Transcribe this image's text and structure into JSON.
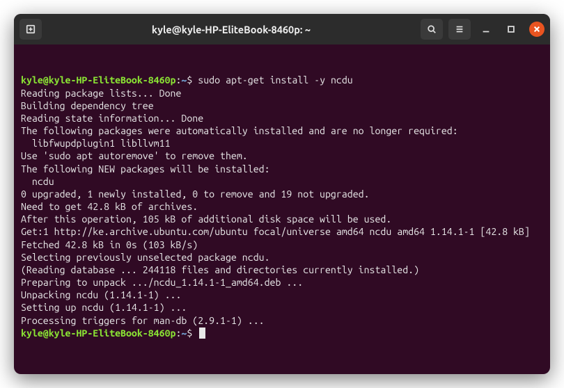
{
  "titlebar": {
    "title": "kyle@kyle-HP-EliteBook-8460p: ~"
  },
  "prompt": {
    "user_host": "kyle@kyle-HP-EliteBook-8460p",
    "colon": ":",
    "path": "~",
    "dollar": "$"
  },
  "command": "sudo apt-get install -y ncdu",
  "output": [
    "Reading package lists... Done",
    "Building dependency tree",
    "Reading state information... Done",
    "The following packages were automatically installed and are no longer required:",
    "  libfwupdplugin1 libllvm11",
    "Use 'sudo apt autoremove' to remove them.",
    "The following NEW packages will be installed:",
    "  ncdu",
    "0 upgraded, 1 newly installed, 0 to remove and 19 not upgraded.",
    "Need to get 42.8 kB of archives.",
    "After this operation, 105 kB of additional disk space will be used.",
    "Get:1 http://ke.archive.ubuntu.com/ubuntu focal/universe amd64 ncdu amd64 1.14.1-1 [42.8 kB]",
    "Fetched 42.8 kB in 0s (103 kB/s)",
    "Selecting previously unselected package ncdu.",
    "(Reading database ... 244118 files and directories currently installed.)",
    "Preparing to unpack .../ncdu_1.14.1-1_amd64.deb ...",
    "Unpacking ncdu (1.14.1-1) ...",
    "Setting up ncdu (1.14.1-1) ...",
    "Processing triggers for man-db (2.9.1-1) ..."
  ]
}
